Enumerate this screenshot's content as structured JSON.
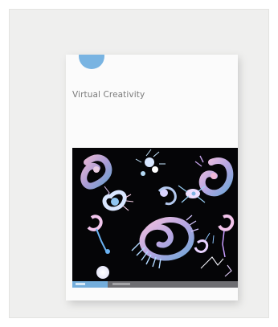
{
  "cover": {
    "title": "Virtual Creativity"
  },
  "colors": {
    "background": "#efefee",
    "badge": "#79b4e2",
    "art_background": "#050507",
    "footer_bar": "#6e6e72",
    "footer_accent": "#73addb"
  }
}
